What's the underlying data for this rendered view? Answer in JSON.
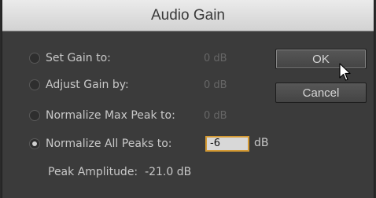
{
  "window": {
    "title": "Audio Gain"
  },
  "options": [
    {
      "label": "Set Gain to:",
      "value": "0 dB",
      "selected": false
    },
    {
      "label": "Adjust Gain by:",
      "value": "0 dB",
      "selected": false
    },
    {
      "label": "Normalize Max Peak to:",
      "value": "0 dB",
      "selected": false
    },
    {
      "label": "Normalize All Peaks to:",
      "value": "-6",
      "unit": "dB",
      "selected": true
    }
  ],
  "buttons": {
    "ok": "OK",
    "cancel": "Cancel"
  },
  "peak": {
    "label": "Peak Amplitude:",
    "value": "-21.0 dB"
  },
  "colors": {
    "focus_border": "#d49a34",
    "dim_text": "#666666"
  },
  "icons": {
    "cursor": "arrow-pointer-icon"
  }
}
